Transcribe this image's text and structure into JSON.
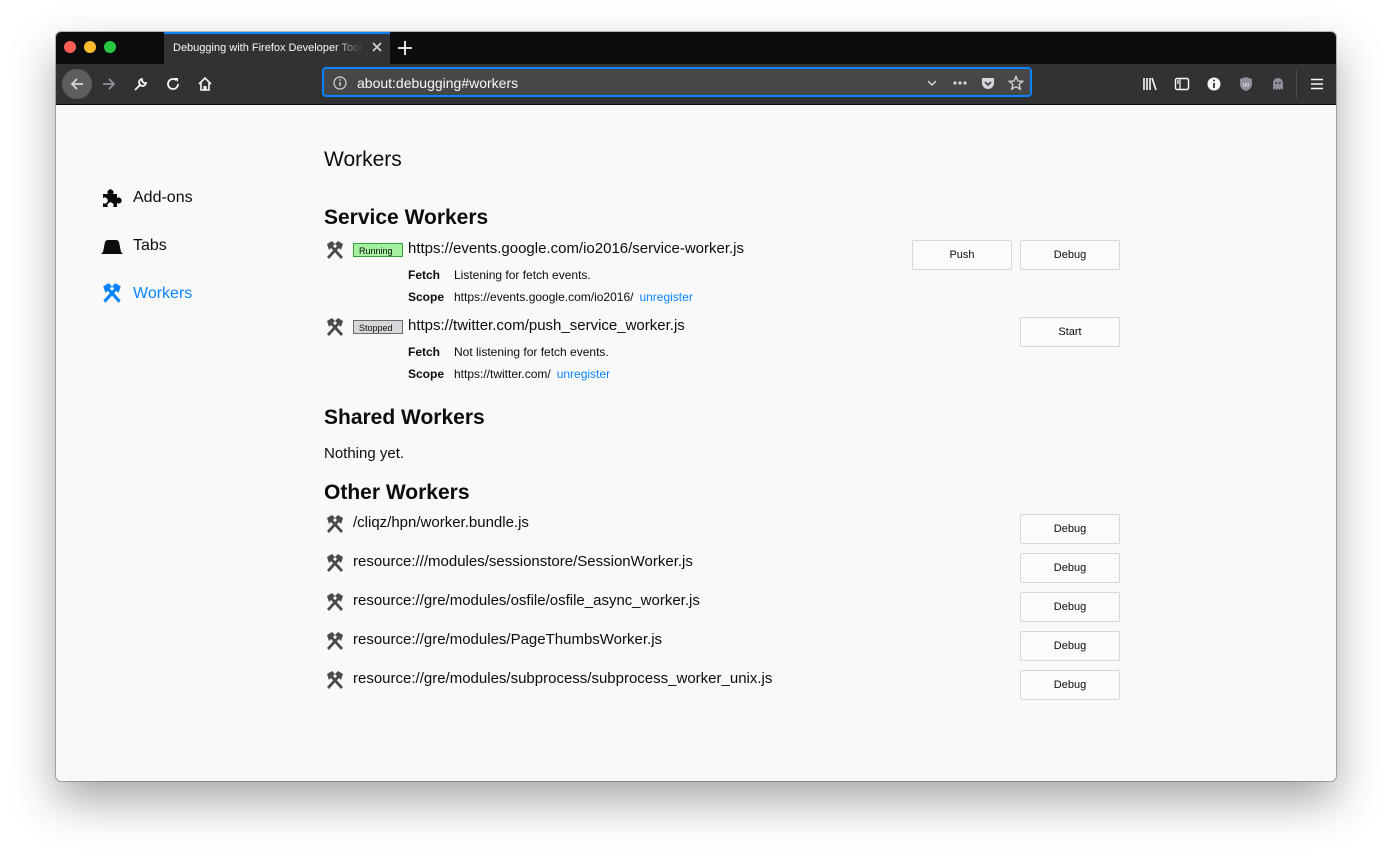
{
  "tab": {
    "title": "Debugging with Firefox Developer Tools"
  },
  "url": {
    "value": "about:debugging#workers"
  },
  "sidebar": {
    "items": [
      {
        "label": "Add-ons",
        "icon": "puzzle-icon"
      },
      {
        "label": "Tabs",
        "icon": "tab-icon"
      },
      {
        "label": "Workers",
        "icon": "workers-icon",
        "selected": true
      }
    ]
  },
  "page": {
    "title": "Workers"
  },
  "service_workers": {
    "heading": "Service Workers",
    "items": [
      {
        "status": "Running",
        "name": "https://events.google.com/io2016/service-worker.js",
        "fetch_label": "Fetch",
        "fetch_value": "Listening for fetch events.",
        "scope_label": "Scope",
        "scope_value": "https://events.google.com/io2016/",
        "unregister": "unregister",
        "push_label": "Push",
        "debug_label": "Debug"
      },
      {
        "status": "Stopped",
        "name": "https://twitter.com/push_service_worker.js",
        "fetch_label": "Fetch",
        "fetch_value": "Not listening for fetch events.",
        "scope_label": "Scope",
        "scope_value": "https://twitter.com/",
        "unregister": "unregister",
        "start_label": "Start"
      }
    ]
  },
  "shared_workers": {
    "heading": "Shared Workers",
    "empty_text": "Nothing yet."
  },
  "other_workers": {
    "heading": "Other Workers",
    "items": [
      {
        "name": "/cliqz/hpn/worker.bundle.js",
        "debug_label": "Debug"
      },
      {
        "name": "resource:///modules/sessionstore/SessionWorker.js",
        "debug_label": "Debug"
      },
      {
        "name": "resource://gre/modules/osfile/osfile_async_worker.js",
        "debug_label": "Debug"
      },
      {
        "name": "resource://gre/modules/PageThumbsWorker.js",
        "debug_label": "Debug"
      },
      {
        "name": "resource://gre/modules/subprocess/subprocess_worker_unix.js",
        "debug_label": "Debug"
      }
    ]
  },
  "colors": {
    "accent": "#0a84ff",
    "running": "#a6f0a1",
    "stopped": "#d7d7db"
  }
}
